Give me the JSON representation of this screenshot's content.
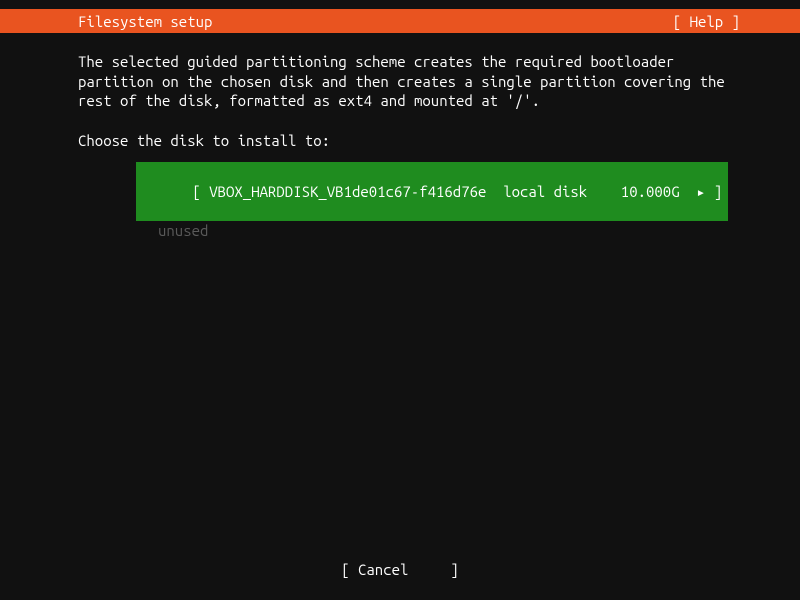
{
  "header": {
    "title": "Filesystem setup",
    "help": "[ Help ]"
  },
  "main": {
    "description": "The selected guided partitioning scheme creates the required bootloader\npartition on the chosen disk and then creates a single partition covering the\nrest of the disk, formatted as ext4 and mounted at '/'.",
    "prompt": "Choose the disk to install to:",
    "disks": [
      {
        "label": "[ VBOX_HARDDISK_VB1de01c67-f416d76e  local disk    10.000G  ▸ ]",
        "status": "unused"
      }
    ]
  },
  "footer": {
    "cancel": "[ Cancel     ]"
  }
}
